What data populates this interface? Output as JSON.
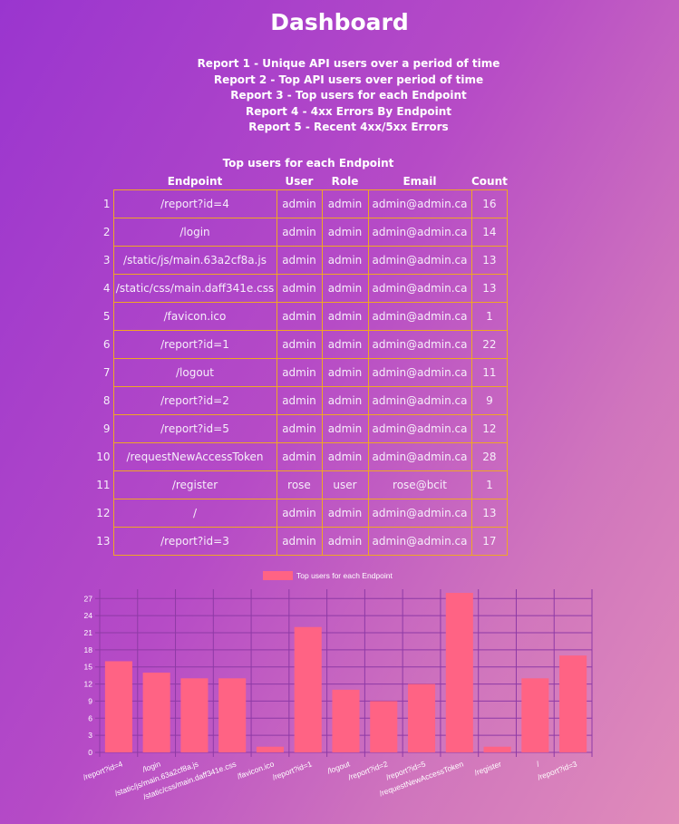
{
  "title": "Dashboard",
  "reports": [
    "Report 1 - Unique API users over a period of time",
    "Report 2 - Top API users over period of time",
    "Report 3 - Top users for each Endpoint",
    "Report 4 - 4xx Errors By Endpoint",
    "Report 5 - Recent 4xx/5xx Errors"
  ],
  "table": {
    "caption": "Top users for each Endpoint",
    "headers": [
      "Endpoint",
      "User",
      "Role",
      "Email",
      "Count"
    ],
    "rows": [
      [
        "1",
        "/report?id=4",
        "admin",
        "admin",
        "admin@admin.ca",
        "16"
      ],
      [
        "2",
        "/login",
        "admin",
        "admin",
        "admin@admin.ca",
        "14"
      ],
      [
        "3",
        "/static/js/main.63a2cf8a.js",
        "admin",
        "admin",
        "admin@admin.ca",
        "13"
      ],
      [
        "4",
        "/static/css/main.daff341e.css",
        "admin",
        "admin",
        "admin@admin.ca",
        "13"
      ],
      [
        "5",
        "/favicon.ico",
        "admin",
        "admin",
        "admin@admin.ca",
        "1"
      ],
      [
        "6",
        "/report?id=1",
        "admin",
        "admin",
        "admin@admin.ca",
        "22"
      ],
      [
        "7",
        "/logout",
        "admin",
        "admin",
        "admin@admin.ca",
        "11"
      ],
      [
        "8",
        "/report?id=2",
        "admin",
        "admin",
        "admin@admin.ca",
        "9"
      ],
      [
        "9",
        "/report?id=5",
        "admin",
        "admin",
        "admin@admin.ca",
        "12"
      ],
      [
        "10",
        "/requestNewAccessToken",
        "admin",
        "admin",
        "admin@admin.ca",
        "28"
      ],
      [
        "11",
        "/register",
        "rose",
        "user",
        "rose@bcit",
        "1"
      ],
      [
        "12",
        "/",
        "admin",
        "admin",
        "admin@admin.ca",
        "13"
      ],
      [
        "13",
        "/report?id=3",
        "admin",
        "admin",
        "admin@admin.ca",
        "17"
      ]
    ]
  },
  "chart_data": {
    "type": "bar",
    "legend": "Top users for each Endpoint",
    "legend_position": "top",
    "categories": [
      "/report?id=4",
      "/login",
      "/static/js/main.63a2cf8a.js",
      "/static/css/main.daff341e.css",
      "/favicon.ico",
      "/report?id=1",
      "/logout",
      "/report?id=2",
      "/report?id=5",
      "/requestNewAccessToken",
      "/register",
      "/",
      "/report?id=3"
    ],
    "series": [
      {
        "name": "Top users for each Endpoint",
        "values": [
          16,
          14,
          13,
          13,
          1,
          22,
          11,
          9,
          12,
          28,
          1,
          13,
          17
        ]
      }
    ],
    "yticks": [
      "0",
      "3",
      "6",
      "9",
      "12",
      "15",
      "18",
      "21",
      "24",
      "27"
    ],
    "ylim": [
      0,
      28
    ],
    "grid": true,
    "bar_color": "#ff6384",
    "grid_color": "#8e3aa6"
  }
}
